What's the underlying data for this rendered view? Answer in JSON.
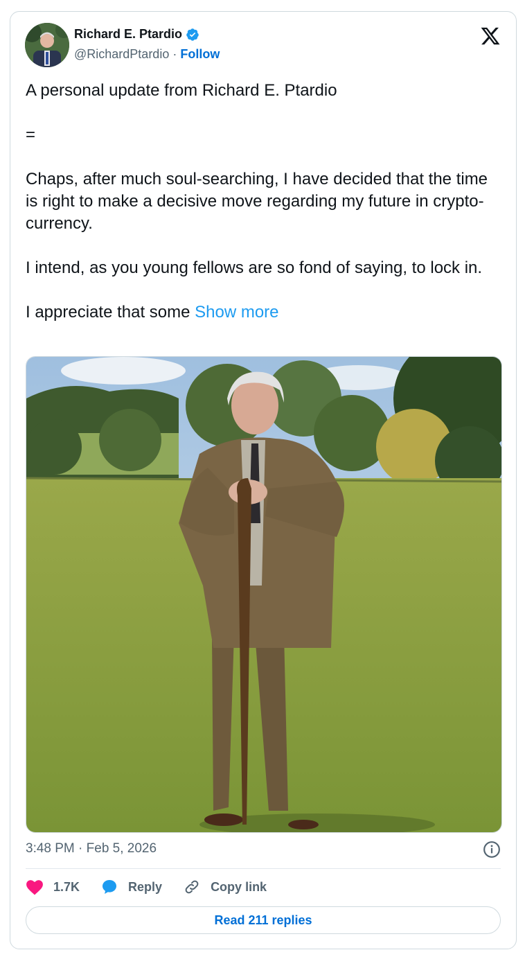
{
  "author": {
    "name": "Richard E. Ptardio",
    "handle": "@RichardPtardio",
    "separator": "·",
    "follow_label": "Follow",
    "verified": true
  },
  "tweet": {
    "paragraphs": [
      "A personal update from Richard E. Ptardio",
      "=",
      "Chaps, after much soul-searching, I have decided that the time is right to make a decisive move regarding my future in crypto-currency.",
      "I intend, as you young fellows are so fond of saying, to lock in."
    ],
    "truncated_text": "I appreciate that some",
    "show_more_label": "Show more",
    "image_icon": "photo-man-with-cane-in-field"
  },
  "meta": {
    "timestamp": "3:48 PM · Feb 5, 2026"
  },
  "actions": {
    "likes": "1.7K",
    "reply_label": "Reply",
    "copy_link_label": "Copy link"
  },
  "read_replies_label": "Read 211 replies",
  "colors": {
    "accent": "#1d9bf0",
    "link": "#006fd6",
    "like": "#f91880",
    "muted": "#536471",
    "border": "#cfd9de"
  }
}
